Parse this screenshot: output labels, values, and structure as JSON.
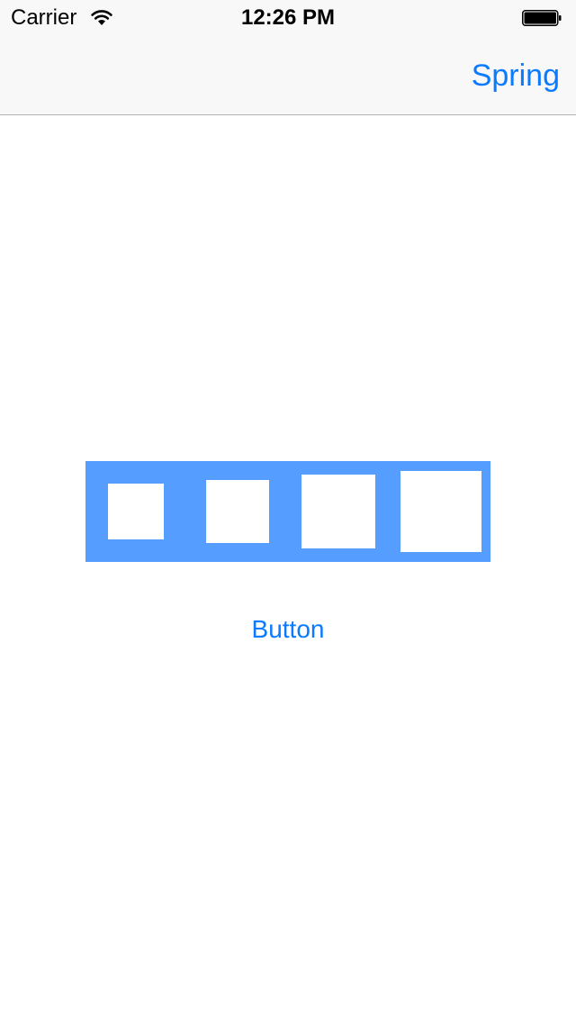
{
  "status_bar": {
    "carrier": "Carrier",
    "time": "12:26 PM",
    "wifi_icon": "wifi-icon",
    "battery_icon": "battery-icon"
  },
  "nav_bar": {
    "right_button_label": "Spring"
  },
  "bar": {
    "color": "#559eff",
    "square_color": "#ffffff"
  },
  "button": {
    "label": "Button",
    "color": "#0a7aff"
  }
}
